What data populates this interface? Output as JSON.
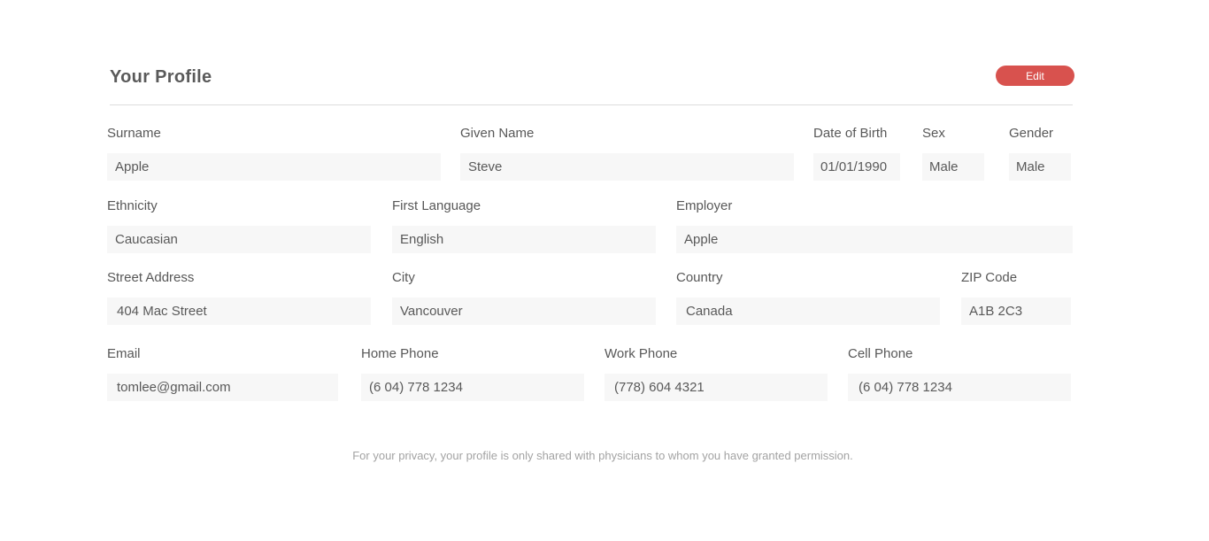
{
  "profile": {
    "title": "Your Profile",
    "edit_label": "Edit"
  },
  "fields": {
    "surname": {
      "label": "Surname",
      "value": "Apple"
    },
    "given_name": {
      "label": "Given Name",
      "value": "Steve"
    },
    "date_of_birth": {
      "label": "Date of Birth",
      "value": "01/01/1990"
    },
    "sex": {
      "label": "Sex",
      "value": "Male"
    },
    "gender": {
      "label": "Gender",
      "value": "Male"
    },
    "ethnicity": {
      "label": "Ethnicity",
      "value": "Caucasian"
    },
    "first_language": {
      "label": "First Language",
      "value": "English"
    },
    "employer": {
      "label": "Employer",
      "value": "Apple"
    },
    "street_address": {
      "label": "Street Address",
      "value": "404 Mac Street"
    },
    "city": {
      "label": "City",
      "value": "Vancouver"
    },
    "country": {
      "label": "Country",
      "value": "Canada"
    },
    "zip_code": {
      "label": "ZIP Code",
      "value": "A1B 2C3"
    },
    "email": {
      "label": "Email",
      "value": "tomlee@gmail.com"
    },
    "home_phone": {
      "label": "Home Phone",
      "value": "(6 04) 778 1234"
    },
    "work_phone": {
      "label": "Work Phone",
      "value": "(778) 604 4321"
    },
    "cell_phone": {
      "label": "Cell Phone",
      "value": "(6 04) 778 1234"
    }
  },
  "footer": {
    "privacy_note": "For your privacy, your profile is only shared with physicians to whom you have granted permission."
  },
  "colors": {
    "accent": "#d8524e",
    "field_bg": "#f7f7f7",
    "divider": "#dcdcdc"
  }
}
